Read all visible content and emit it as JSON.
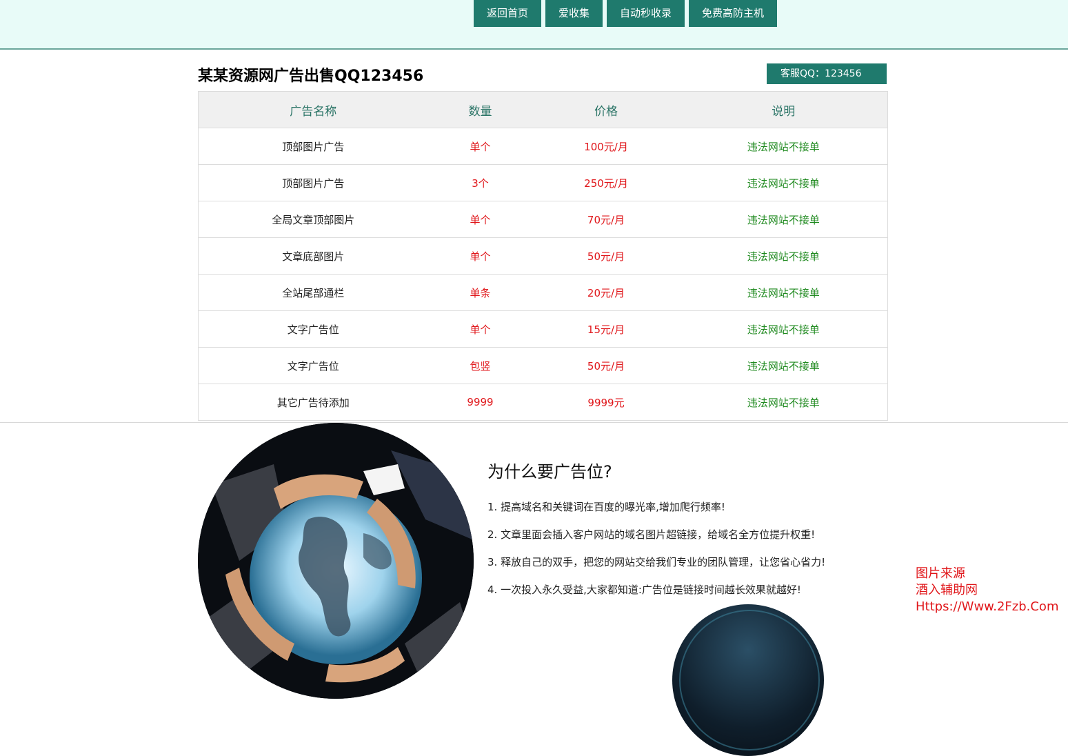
{
  "nav": {
    "items": [
      "返回首页",
      "爱收集",
      "自动秒收录",
      "免费高防主机"
    ]
  },
  "header": {
    "title": "某某资源网广告出售QQ123456",
    "kefu": "客服QQ：123456"
  },
  "table": {
    "headers": [
      "广告名称",
      "数量",
      "价格",
      "说明"
    ],
    "rows": [
      [
        "顶部图片广告",
        "单个",
        "100元/月",
        "违法网站不接单"
      ],
      [
        "顶部图片广告",
        "3个",
        "250元/月",
        "违法网站不接单"
      ],
      [
        "全局文章顶部图片",
        "单个",
        "70元/月",
        "违法网站不接单"
      ],
      [
        "文章底部图片",
        "单个",
        "50元/月",
        "违法网站不接单"
      ],
      [
        "全站尾部通栏",
        "单条",
        "20元/月",
        "违法网站不接单"
      ],
      [
        "文字广告位",
        "单个",
        "15元/月",
        "违法网站不接单"
      ],
      [
        "文字广告位",
        "包竖",
        "50元/月",
        "违法网站不接单"
      ],
      [
        "其它广告待添加",
        "9999",
        "9999元",
        "违法网站不接单"
      ]
    ]
  },
  "why": {
    "title": "为什么要广告位?",
    "items": [
      "1. 提高域名和关键词在百度的曝光率,增加爬行频率!",
      "2. 文章里面会插入客户网站的域名图片超链接，给域名全方位提升权重!",
      "3. 释放自己的双手，把您的网站交给我们专业的团队管理，让您省心省力!",
      "4. 一次投入永久受益,大家都知道:广告位是链接时间越长效果就越好!"
    ]
  },
  "watermark": {
    "line1": "图片来源",
    "line2": "酒入辅助网",
    "line3": "Https://Www.2Fzb.Com"
  },
  "colors": {
    "accent": "#1f7a6d",
    "topbar_bg": "#e8fbf8",
    "price_red": "#e0161a",
    "note_green": "#1f8a1f"
  }
}
